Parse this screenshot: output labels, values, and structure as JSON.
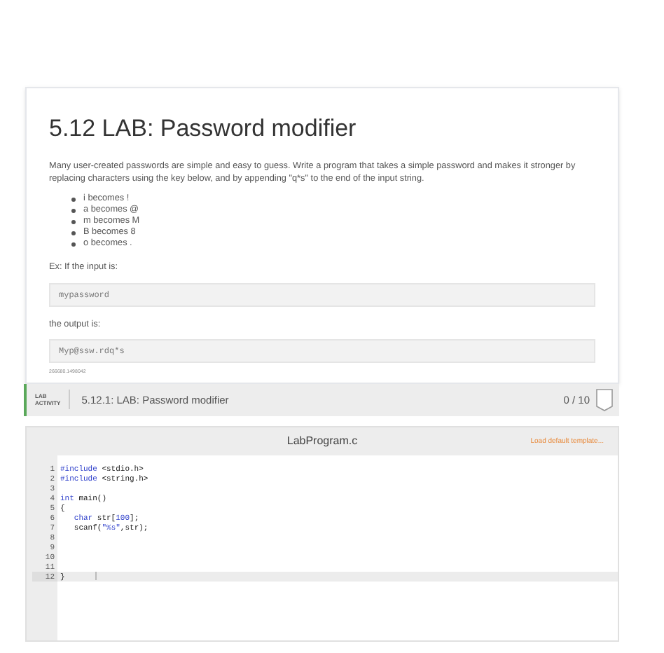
{
  "lab": {
    "title": "5.12 LAB: Password modifier",
    "intro": "Many user-created passwords are simple and easy to guess. Write a program that takes a simple password and makes it stronger by replacing characters using the key below, and by appending \"q*s\" to the end of the input string.",
    "rules": [
      "i becomes !",
      "a becomes @",
      "m becomes M",
      "B becomes 8",
      "o becomes ."
    ],
    "input_label": "Ex: If the input is:",
    "input_example": "mypassword",
    "output_label": "the output is:",
    "output_example": "Myp@ssw.rdq*s",
    "id_caption": "266680.1498042"
  },
  "activity": {
    "tag_line_1": "LAB",
    "tag_line_2": "ACTIVITY",
    "title": "5.12.1: LAB: Password modifier",
    "score": "0 / 10"
  },
  "editor": {
    "filename": "LabProgram.c",
    "template_link": "Load default template...",
    "lines": [
      {
        "number": "1",
        "active": false,
        "segments": [
          {
            "text": "#include",
            "kind": "keyword"
          },
          {
            "text": " <stdio.h>",
            "kind": "plain"
          }
        ]
      },
      {
        "number": "2",
        "active": false,
        "segments": [
          {
            "text": "#include",
            "kind": "keyword"
          },
          {
            "text": " <string.h>",
            "kind": "plain"
          }
        ]
      },
      {
        "number": "3",
        "active": false
      },
      {
        "number": "4",
        "active": false,
        "segments": [
          {
            "text": "int",
            "kind": "keyword"
          },
          {
            "text": " main()",
            "kind": "plain"
          }
        ]
      },
      {
        "number": "5",
        "active": false,
        "segments": [
          {
            "text": "{",
            "kind": "plain"
          }
        ]
      },
      {
        "number": "6",
        "active": false,
        "segments": [
          {
            "text": "   char",
            "kind": "keyword"
          },
          {
            "text": " str[",
            "kind": "plain"
          },
          {
            "text": "100",
            "kind": "number"
          },
          {
            "text": "];",
            "kind": "plain"
          }
        ]
      },
      {
        "number": "7",
        "active": false,
        "segments": [
          {
            "text": "   scanf(",
            "kind": "plain"
          },
          {
            "text": "\"%s\"",
            "kind": "string"
          },
          {
            "text": ",str);",
            "kind": "plain"
          }
        ]
      },
      {
        "number": "8",
        "active": false
      },
      {
        "number": "9",
        "active": false
      },
      {
        "number": "10",
        "active": false
      },
      {
        "number": "11",
        "active": false
      },
      {
        "number": "12",
        "active": true,
        "segments": [
          {
            "text": "}",
            "kind": "plain"
          }
        ]
      }
    ]
  }
}
